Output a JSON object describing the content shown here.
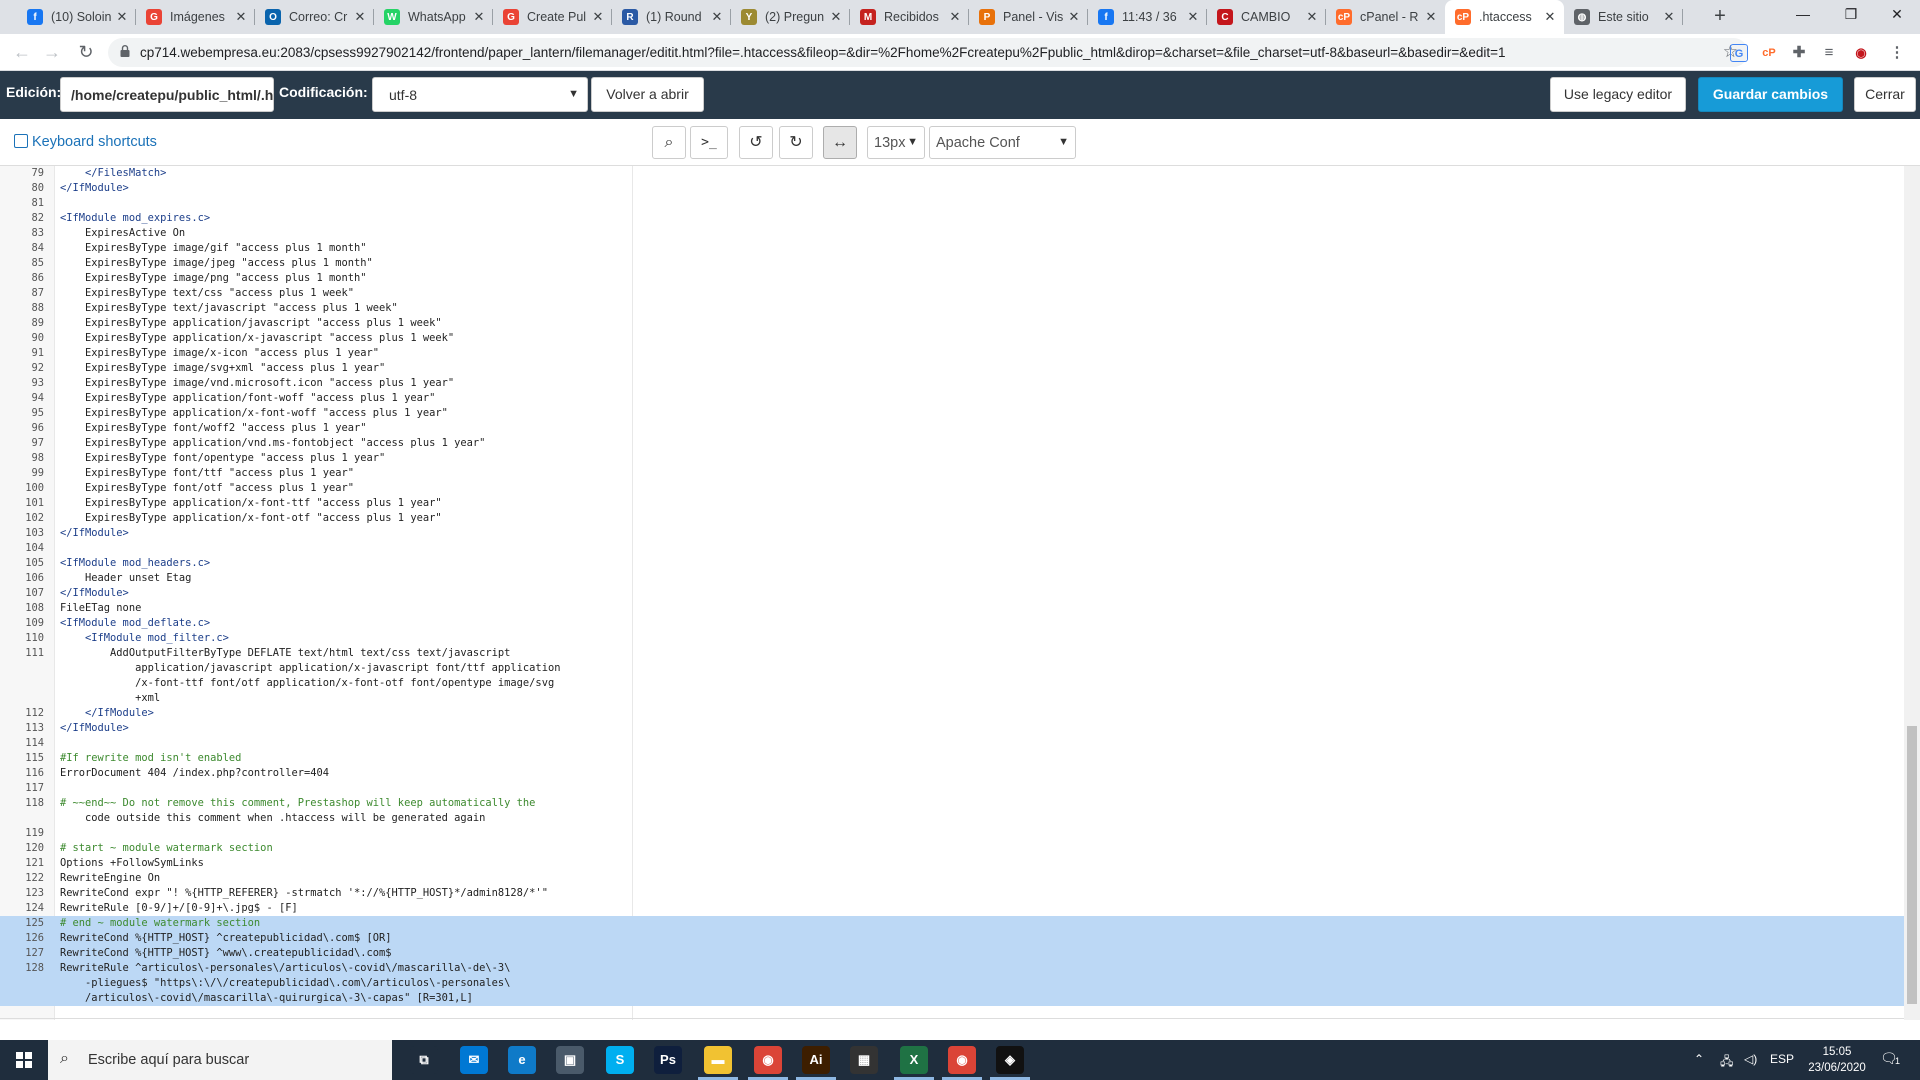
{
  "browser": {
    "tabs": [
      {
        "title": "(10) Soloin",
        "icon": "facebook-icon",
        "color": "#1877f2",
        "glyph": "f"
      },
      {
        "title": "Imágenes",
        "icon": "google-icon",
        "color": "#ea4335",
        "glyph": "G"
      },
      {
        "title": "Correo: Cr",
        "icon": "outlook-icon",
        "color": "#0a64ad",
        "glyph": "O"
      },
      {
        "title": "WhatsApp",
        "icon": "whatsapp-icon",
        "color": "#25d366",
        "glyph": "W"
      },
      {
        "title": "Create Pul",
        "icon": "google-icon",
        "color": "#ea4335",
        "glyph": "G"
      },
      {
        "title": "(1) Round",
        "icon": "support-icon",
        "color": "#2b5aa5",
        "glyph": "R"
      },
      {
        "title": "(2) Pregun",
        "icon": "yahoo-icon",
        "color": "#9c8a32",
        "glyph": "Y"
      },
      {
        "title": "Recibidos",
        "icon": "gmail-icon",
        "color": "#c5221f",
        "glyph": "M"
      },
      {
        "title": "Panel - Vis",
        "icon": "panel-icon",
        "color": "#e8710a",
        "glyph": "P"
      },
      {
        "title": "11:43 / 36",
        "icon": "facebook-icon",
        "color": "#1877f2",
        "glyph": "f"
      },
      {
        "title": "CAMBIO",
        "icon": "media-icon",
        "color": "#c4161c",
        "glyph": "C"
      },
      {
        "title": "cPanel - R",
        "icon": "cpanel-icon",
        "color": "#ff6c2c",
        "glyph": "cP"
      },
      {
        "title": ".htaccess",
        "icon": "cpanel-icon",
        "color": "#ff6c2c",
        "glyph": "cP",
        "active": true
      },
      {
        "title": "Este sitio",
        "icon": "globe-icon",
        "color": "#5f6368",
        "glyph": "◍"
      }
    ],
    "url": "cp714.webempresa.eu:2083/cpsess9927902142/frontend/paper_lantern/filemanager/editit.html?file=.htaccess&fileop=&dir=%2Fhome%2Fcreatepu%2Fpublic_html&dirop=&charset=&file_charset=utf-8&baseurl=&basedir=&edit=1"
  },
  "editor_header": {
    "edit_label": "Edición:",
    "path_value": "/home/createpu/public_html/.htaccess",
    "encoding_label": "Codificación:",
    "encoding_value": "utf-8",
    "reopen_button": "Volver a abrir",
    "legacy_button": "Use legacy editor",
    "save_button": "Guardar cambios",
    "close_button": "Cerrar"
  },
  "toolbar": {
    "keyboard_shortcuts": "Keyboard shortcuts",
    "font_size": "13px",
    "mode": "Apache Conf"
  },
  "code_lines": [
    {
      "n": "79",
      "t": "    </FilesMatch>"
    },
    {
      "n": "80",
      "t": "</IfModule>"
    },
    {
      "n": "81",
      "t": ""
    },
    {
      "n": "82",
      "t": "<IfModule mod_expires.c>"
    },
    {
      "n": "83",
      "t": "    ExpiresActive On"
    },
    {
      "n": "84",
      "t": "    ExpiresByType image/gif \"access plus 1 month\""
    },
    {
      "n": "85",
      "t": "    ExpiresByType image/jpeg \"access plus 1 month\""
    },
    {
      "n": "86",
      "t": "    ExpiresByType image/png \"access plus 1 month\""
    },
    {
      "n": "87",
      "t": "    ExpiresByType text/css \"access plus 1 week\""
    },
    {
      "n": "88",
      "t": "    ExpiresByType text/javascript \"access plus 1 week\""
    },
    {
      "n": "89",
      "t": "    ExpiresByType application/javascript \"access plus 1 week\""
    },
    {
      "n": "90",
      "t": "    ExpiresByType application/x-javascript \"access plus 1 week\""
    },
    {
      "n": "91",
      "t": "    ExpiresByType image/x-icon \"access plus 1 year\""
    },
    {
      "n": "92",
      "t": "    ExpiresByType image/svg+xml \"access plus 1 year\""
    },
    {
      "n": "93",
      "t": "    ExpiresByType image/vnd.microsoft.icon \"access plus 1 year\""
    },
    {
      "n": "94",
      "t": "    ExpiresByType application/font-woff \"access plus 1 year\""
    },
    {
      "n": "95",
      "t": "    ExpiresByType application/x-font-woff \"access plus 1 year\""
    },
    {
      "n": "96",
      "t": "    ExpiresByType font/woff2 \"access plus 1 year\""
    },
    {
      "n": "97",
      "t": "    ExpiresByType application/vnd.ms-fontobject \"access plus 1 year\""
    },
    {
      "n": "98",
      "t": "    ExpiresByType font/opentype \"access plus 1 year\""
    },
    {
      "n": "99",
      "t": "    ExpiresByType font/ttf \"access plus 1 year\""
    },
    {
      "n": "100",
      "t": "    ExpiresByType font/otf \"access plus 1 year\""
    },
    {
      "n": "101",
      "t": "    ExpiresByType application/x-font-ttf \"access plus 1 year\""
    },
    {
      "n": "102",
      "t": "    ExpiresByType application/x-font-otf \"access plus 1 year\""
    },
    {
      "n": "103",
      "t": "</IfModule>"
    },
    {
      "n": "104",
      "t": ""
    },
    {
      "n": "105",
      "t": "<IfModule mod_headers.c>"
    },
    {
      "n": "106",
      "t": "    Header unset Etag"
    },
    {
      "n": "107",
      "t": "</IfModule>"
    },
    {
      "n": "108",
      "t": "FileETag none"
    },
    {
      "n": "109",
      "t": "<IfModule mod_deflate.c>"
    },
    {
      "n": "110",
      "t": "    <IfModule mod_filter.c>"
    },
    {
      "n": "111",
      "t": "        AddOutputFilterByType DEFLATE text/html text/css text/javascript"
    },
    {
      "n": "",
      "t": "            application/javascript application/x-javascript font/ttf application"
    },
    {
      "n": "",
      "t": "            /x-font-ttf font/otf application/x-font-otf font/opentype image/svg"
    },
    {
      "n": "",
      "t": "            +xml"
    },
    {
      "n": "112",
      "t": "    </IfModule>"
    },
    {
      "n": "113",
      "t": "</IfModule>"
    },
    {
      "n": "114",
      "t": ""
    },
    {
      "n": "115",
      "t": "#If rewrite mod isn't enabled"
    },
    {
      "n": "116",
      "t": "ErrorDocument 404 /index.php?controller=404"
    },
    {
      "n": "117",
      "t": ""
    },
    {
      "n": "118",
      "t": "# ~~end~~ Do not remove this comment, Prestashop will keep automatically the"
    },
    {
      "n": "",
      "t": "    code outside this comment when .htaccess will be generated again"
    },
    {
      "n": "119",
      "t": ""
    },
    {
      "n": "120",
      "t": "# start ~ module watermark section"
    },
    {
      "n": "121",
      "t": "Options +FollowSymLinks"
    },
    {
      "n": "122",
      "t": "RewriteEngine On"
    },
    {
      "n": "123",
      "t": "RewriteCond expr \"! %{HTTP_REFERER} -strmatch '*://%{HTTP_HOST}*/admin8128/*'\""
    },
    {
      "n": "124",
      "t": "RewriteRule [0-9/]+/[0-9]+\\.jpg$ - [F]"
    },
    {
      "n": "125",
      "t": "# end ~ module watermark section",
      "sel": true
    },
    {
      "n": "126",
      "t": "RewriteCond %{HTTP_HOST} ^createpublicidad\\.com$ [OR]",
      "sel": true
    },
    {
      "n": "127",
      "t": "RewriteCond %{HTTP_HOST} ^www\\.createpublicidad\\.com$",
      "sel": true
    },
    {
      "n": "128",
      "t": "RewriteRule ^articulos\\-personales\\/articulos\\-covid\\/mascarilla\\-de\\-3\\",
      "sel": true
    },
    {
      "n": "",
      "t": "    -pliegues$ \"https\\:\\/\\/createpublicidad\\.com\\/articulos\\-personales\\",
      "sel": true
    },
    {
      "n": "",
      "t": "    /articulos\\-covid\\/mascarilla\\-quirurgica\\-3\\-capas\" [R=301,L]",
      "sel": true
    },
    {
      "n": "",
      "t": ""
    },
    {
      "n": "129",
      "t": ""
    }
  ],
  "taskbar": {
    "search_placeholder": "Escribe aquí para buscar",
    "apps": [
      {
        "name": "task-view-icon",
        "glyph": "⧉",
        "color": "#1f2d3d"
      },
      {
        "name": "mail-icon",
        "glyph": "✉",
        "color": "#0078d4"
      },
      {
        "name": "edge-icon",
        "glyph": "e",
        "color": "#0f7ac8"
      },
      {
        "name": "store-icon",
        "glyph": "▣",
        "color": "#4a5a6a"
      },
      {
        "name": "skype-icon",
        "glyph": "S",
        "color": "#00aff0"
      },
      {
        "name": "photoshop-icon",
        "glyph": "Ps",
        "color": "#0f1f3d"
      },
      {
        "name": "file-explorer-icon",
        "glyph": "▬",
        "color": "#f1c232"
      },
      {
        "name": "chrome-icon",
        "glyph": "◉",
        "color": "#db4437"
      },
      {
        "name": "illustrator-icon",
        "glyph": "Ai",
        "color": "#3d1e00"
      },
      {
        "name": "calculator-icon",
        "glyph": "▦",
        "color": "#333"
      },
      {
        "name": "excel-icon",
        "glyph": "X",
        "color": "#1f7244"
      },
      {
        "name": "chrome-profile-icon",
        "glyph": "◉",
        "color": "#db4437"
      },
      {
        "name": "app-icon",
        "glyph": "◈",
        "color": "#111"
      }
    ],
    "language": "ESP",
    "time": "15:05",
    "date": "23/06/2020",
    "notifications": "1"
  }
}
